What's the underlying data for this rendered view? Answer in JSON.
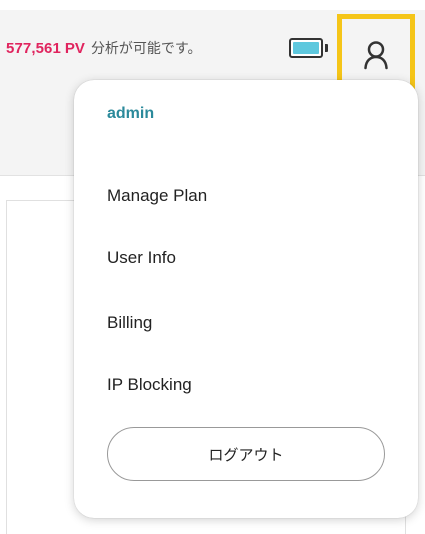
{
  "header": {
    "pv_count": "577,561",
    "pv_unit": "PV",
    "pv_message": "分析が可能です。",
    "battery_icon": "battery-icon",
    "user_icon": "user-icon",
    "accent_color": "#e0245e",
    "highlight_color": "#f5c518"
  },
  "dropdown": {
    "username": "admin",
    "items": [
      {
        "label": "Manage Plan"
      },
      {
        "label": "User Info"
      },
      {
        "label": "Billing"
      },
      {
        "label": "IP Blocking"
      }
    ],
    "logout_label": "ログアウト"
  }
}
